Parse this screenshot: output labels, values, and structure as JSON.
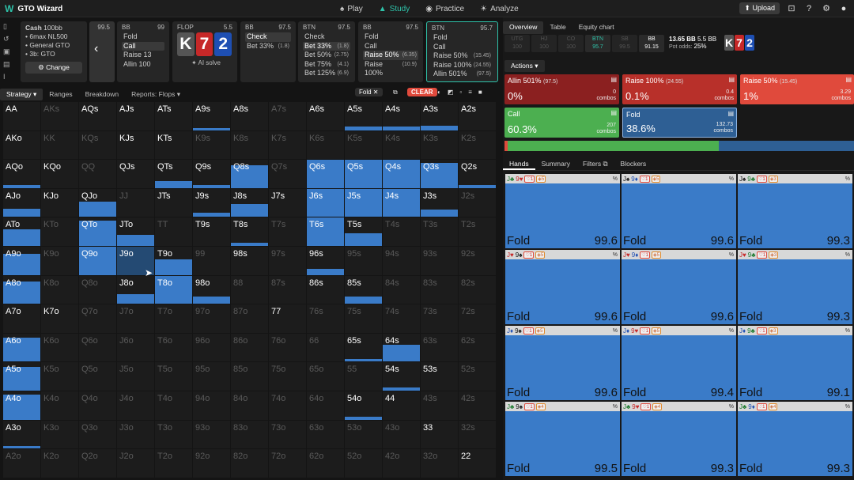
{
  "app": {
    "title": "GTO Wizard"
  },
  "nav": [
    {
      "label": "Play",
      "icon": "spade-icon"
    },
    {
      "label": "Study",
      "icon": "graduation-cap-icon",
      "active": true
    },
    {
      "label": "Practice",
      "icon": "controller-icon"
    },
    {
      "label": "Analyze",
      "icon": "lightbulb-icon"
    }
  ],
  "toolbar": {
    "upload_label": "Upload"
  },
  "game": {
    "title": "Cash",
    "stack": "100bb",
    "format": "6max NL500",
    "solution": "General GTO",
    "sizing": "3b: GTO",
    "change_label": "Change"
  },
  "backnav": {
    "value": "99.5"
  },
  "cards": [
    {
      "pos": "BB",
      "stack": "99",
      "items": [
        {
          "label": "Fold",
          "v": ""
        },
        {
          "label": "Call",
          "v": "",
          "sel": true
        },
        {
          "label": "Raise 13",
          "v": ""
        },
        {
          "label": "Allin 100",
          "v": ""
        }
      ]
    },
    {
      "pos": "BB",
      "stack": "97.5",
      "items": [
        {
          "label": "Check",
          "v": "",
          "sel": true
        },
        {
          "label": "Bet 33%",
          "v": "(1.8)"
        }
      ]
    },
    {
      "pos": "BTN",
      "stack": "97.5",
      "items": [
        {
          "label": "Check",
          "v": ""
        },
        {
          "label": "Bet 33%",
          "v": "(1.8)",
          "sel": true
        },
        {
          "label": "Bet 50%",
          "v": "(2.75)"
        },
        {
          "label": "Bet 75%",
          "v": "(4.1)"
        },
        {
          "label": "Bet 125%",
          "v": "(6.9)"
        }
      ]
    },
    {
      "pos": "BB",
      "stack": "97.5",
      "items": [
        {
          "label": "Fold",
          "v": ""
        },
        {
          "label": "Call",
          "v": ""
        },
        {
          "label": "Raise 50%",
          "v": "(6.35)",
          "sel": true
        },
        {
          "label": "Raise 100%",
          "v": "(10.9)"
        }
      ]
    },
    {
      "pos": "BTN",
      "stack": "95.7",
      "items": [
        {
          "label": "Fold",
          "v": ""
        },
        {
          "label": "Call",
          "v": ""
        },
        {
          "label": "Raise 50%",
          "v": "(15.45)"
        },
        {
          "label": "Raise 100%",
          "v": "(24.55)"
        },
        {
          "label": "Allin 501%",
          "v": "(97.5)"
        }
      ]
    }
  ],
  "flop": {
    "label": "FLOP",
    "pot": "5.5",
    "ai_label": "AI solve",
    "cards": [
      {
        "rank": "K",
        "color": "#555555"
      },
      {
        "rank": "7",
        "color": "#c62828"
      },
      {
        "rank": "2",
        "color": "#1e4fb3"
      }
    ]
  },
  "filters": {
    "tabs": [
      "Strategy",
      "Ranges",
      "Breakdown",
      "Reports: Flops"
    ],
    "chip": "Fold",
    "clear": "CLEAR"
  },
  "matrix": [
    [
      "AA",
      "AKs",
      "AQs",
      "AJs",
      "ATs",
      "A9s",
      "A8s",
      "A7s",
      "A6s",
      "A5s",
      "A4s",
      "A3s",
      "A2s"
    ],
    [
      "AKo",
      "KK",
      "KQs",
      "KJs",
      "KTs",
      "K9s",
      "K8s",
      "K7s",
      "K6s",
      "K5s",
      "K4s",
      "K3s",
      "K2s"
    ],
    [
      "AQo",
      "KQo",
      "QQ",
      "QJs",
      "QTs",
      "Q9s",
      "Q8s",
      "Q7s",
      "Q6s",
      "Q5s",
      "Q4s",
      "Q3s",
      "Q2s"
    ],
    [
      "AJo",
      "KJo",
      "QJo",
      "JJ",
      "JTs",
      "J9s",
      "J8s",
      "J7s",
      "J6s",
      "J5s",
      "J4s",
      "J3s",
      "J2s"
    ],
    [
      "ATo",
      "KTo",
      "QTo",
      "JTo",
      "TT",
      "T9s",
      "T8s",
      "T7s",
      "T6s",
      "T5s",
      "T4s",
      "T3s",
      "T2s"
    ],
    [
      "A9o",
      "K9o",
      "Q9o",
      "J9o",
      "T9o",
      "99",
      "98s",
      "97s",
      "96s",
      "95s",
      "94s",
      "93s",
      "92s"
    ],
    [
      "A8o",
      "K8o",
      "Q8o",
      "J8o",
      "T8o",
      "98o",
      "88",
      "87s",
      "86s",
      "85s",
      "84s",
      "83s",
      "82s"
    ],
    [
      "A7o",
      "K7o",
      "Q7o",
      "J7o",
      "T7o",
      "97o",
      "87o",
      "77",
      "76s",
      "75s",
      "74s",
      "73s",
      "72s"
    ],
    [
      "A6o",
      "K6o",
      "Q6o",
      "J6o",
      "T6o",
      "96o",
      "86o",
      "76o",
      "66",
      "65s",
      "64s",
      "63s",
      "62s"
    ],
    [
      "A5o",
      "K5o",
      "Q5o",
      "J5o",
      "T5o",
      "95o",
      "85o",
      "75o",
      "65o",
      "55",
      "54s",
      "53s",
      "52s"
    ],
    [
      "A4o",
      "K4o",
      "Q4o",
      "J4o",
      "T4o",
      "94o",
      "84o",
      "74o",
      "64o",
      "54o",
      "44",
      "43s",
      "42s"
    ],
    [
      "A3o",
      "K3o",
      "Q3o",
      "J3o",
      "T3o",
      "93o",
      "83o",
      "73o",
      "63o",
      "53o",
      "43o",
      "33",
      "32s"
    ],
    [
      "A2o",
      "K2o",
      "Q2o",
      "J2o",
      "T2o",
      "92o",
      "82o",
      "72o",
      "62o",
      "52o",
      "42o",
      "32o",
      "22"
    ]
  ],
  "right": {
    "tabs": [
      "Overview",
      "Table",
      "Equity chart"
    ],
    "positions": [
      {
        "p": "UTG",
        "s": "100"
      },
      {
        "p": "HJ",
        "s": "100"
      },
      {
        "p": "CO",
        "s": "100"
      },
      {
        "p": "BTN",
        "s": "95.7"
      },
      {
        "p": "SB",
        "s": "99.5"
      },
      {
        "p": "BB",
        "s": "91.15"
      }
    ],
    "pot": "13.65 BB",
    "pot2": "5.5 BB",
    "pot_odds_label": "Pot odds:",
    "pot_odds": "25%",
    "actions_label": "Actions",
    "actions": [
      {
        "name": "Allin 501%",
        "v": "(97.5)",
        "pct": "0%",
        "combos": "0",
        "color": "#8b2020"
      },
      {
        "name": "Raise 100%",
        "v": "(24.55)",
        "pct": "0.1%",
        "combos": "0.4",
        "color": "#b8302a"
      },
      {
        "name": "Raise 50%",
        "v": "(15.45)",
        "pct": "1%",
        "combos": "3.29",
        "color": "#e04a3c"
      },
      {
        "name": "Call",
        "v": "",
        "pct": "60.3%",
        "combos": "207",
        "color": "#4caf50"
      },
      {
        "name": "Fold",
        "v": "",
        "pct": "38.6%",
        "combos": "132.73",
        "color": "#2e5f94"
      }
    ],
    "combos_label": "combos",
    "hand_tabs": [
      "Hands",
      "Summary",
      "Filters",
      "Blockers"
    ],
    "hands": [
      {
        "c1": "J♣",
        "c1c": "grn",
        "c2": "9♥",
        "c2c": "red",
        "b1": "1",
        "b2": "5",
        "action": "Fold",
        "value": "99.6"
      },
      {
        "c1": "J♠",
        "c1c": "blk",
        "c2": "9♦",
        "c2c": "blu",
        "b1": "1",
        "b2": "5",
        "action": "Fold",
        "value": "99.6"
      },
      {
        "c1": "J♠",
        "c1c": "blk",
        "c2": "9♣",
        "c2c": "grn",
        "b1": "1",
        "b2": "3",
        "action": "Fold",
        "value": "99.3"
      },
      {
        "c1": "J♥",
        "c1c": "red",
        "c2": "9♠",
        "c2c": "blk",
        "b1": "1",
        "b2": "5",
        "action": "Fold",
        "value": "99.6"
      },
      {
        "c1": "J♥",
        "c1c": "red",
        "c2": "9♦",
        "c2c": "blu",
        "b1": "1",
        "b2": "5",
        "action": "Fold",
        "value": "99.6"
      },
      {
        "c1": "J♥",
        "c1c": "red",
        "c2": "9♣",
        "c2c": "grn",
        "b1": "1",
        "b2": "3",
        "action": "Fold",
        "value": "99.3"
      },
      {
        "c1": "J♦",
        "c1c": "blu",
        "c2": "9♠",
        "c2c": "blk",
        "b1": "1",
        "b2": "5",
        "action": "Fold",
        "value": "99.6"
      },
      {
        "c1": "J♦",
        "c1c": "blu",
        "c2": "9♥",
        "c2c": "red",
        "b1": "1",
        "b2": "5",
        "action": "Fold",
        "value": "99.4"
      },
      {
        "c1": "J♦",
        "c1c": "blu",
        "c2": "9♣",
        "c2c": "grn",
        "b1": "1",
        "b2": "3",
        "action": "Fold",
        "value": "99.1"
      },
      {
        "c1": "J♣",
        "c1c": "grn",
        "c2": "9♠",
        "c2c": "blk",
        "b1": "1",
        "b2": "4",
        "action": "Fold",
        "value": "99.5"
      },
      {
        "c1": "J♣",
        "c1c": "grn",
        "c2": "9♥",
        "c2c": "red",
        "b1": "1",
        "b2": "4",
        "action": "Fold",
        "value": "99.3"
      },
      {
        "c1": "J♣",
        "c1c": "grn",
        "c2": "9♦",
        "c2c": "blu",
        "b1": "1",
        "b2": "4",
        "action": "Fold",
        "value": "99.3"
      }
    ]
  }
}
